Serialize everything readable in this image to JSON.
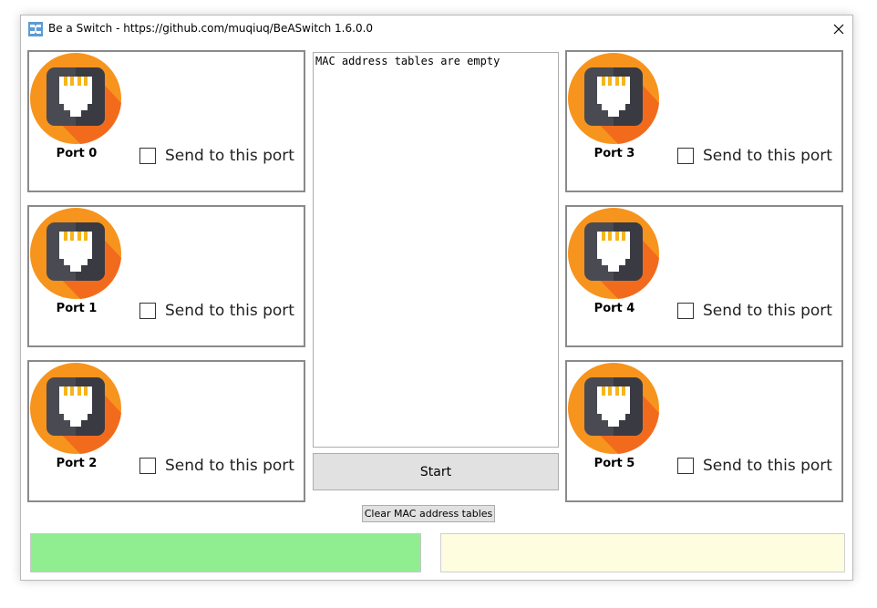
{
  "window": {
    "title": "Be a Switch - https://github.com/muqiuq/BeASwitch 1.6.0.0"
  },
  "ports": [
    {
      "label": "Port 0",
      "checkbox_label": "Send to this port",
      "checked": false
    },
    {
      "label": "Port 1",
      "checkbox_label": "Send to this port",
      "checked": false
    },
    {
      "label": "Port 2",
      "checkbox_label": "Send to this port",
      "checked": false
    },
    {
      "label": "Port 3",
      "checkbox_label": "Send to this port",
      "checked": false
    },
    {
      "label": "Port 4",
      "checkbox_label": "Send to this port",
      "checked": false
    },
    {
      "label": "Port 5",
      "checkbox_label": "Send to this port",
      "checked": false
    }
  ],
  "mac_table": {
    "text": "MAC address tables are empty"
  },
  "buttons": {
    "start": "Start",
    "clear": "Clear MAC address tables"
  },
  "colors": {
    "status_left": "#90ee90",
    "status_right": "#fffde0",
    "port_icon_orange": "#f7941d",
    "port_icon_dark": "#4a4a52"
  },
  "icons": {
    "port": "ethernet-port-icon",
    "app": "switch-app-icon",
    "close": "close-icon"
  }
}
